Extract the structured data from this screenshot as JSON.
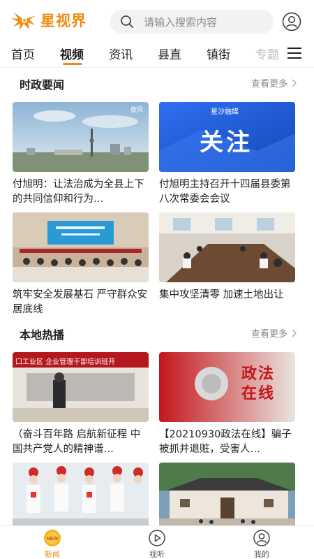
{
  "app": {
    "name": "星视界",
    "brand_color": "#f08a12"
  },
  "search": {
    "placeholder": "请输入搜索内容"
  },
  "nav": {
    "tabs": [
      {
        "label": "首页",
        "active": false
      },
      {
        "label": "视频",
        "active": true
      },
      {
        "label": "资讯",
        "active": false
      },
      {
        "label": "县直",
        "active": false
      },
      {
        "label": "镇街",
        "active": false
      },
      {
        "label": "专题",
        "active": false
      }
    ],
    "menu_icon": "hamburger-menu-icon"
  },
  "sections": [
    {
      "title": "时政要闻",
      "more_label": "查看更多",
      "items": [
        {
          "title": "付旭明：让法治成为全县上下的共同信仰和行为…",
          "thumb_label": "旋风"
        },
        {
          "title": "付旭明主持召开十四届县委第八次常委会会议",
          "thumb_label": "关注",
          "thumb_brand": "星沙融媒"
        },
        {
          "title": "筑牢安全发展基石 严守群众安居底线",
          "thumb_label": ""
        },
        {
          "title": "集中攻坚清零 加速土地出让",
          "thumb_label": ""
        }
      ]
    },
    {
      "title": "本地热播",
      "more_label": "查看更多",
      "items": [
        {
          "title": "（奋斗百年路 启航新征程 中国共产党人的精神谱…",
          "thumb_label": "口工业区 企业管理干部培训班开"
        },
        {
          "title": "【20210930政法在线】骗子被抓并退赃，受害人…",
          "thumb_label": "政法在线"
        },
        {
          "title": "",
          "thumb_label": ""
        },
        {
          "title": "",
          "thumb_label": ""
        }
      ]
    }
  ],
  "bottom_bar": {
    "items": [
      {
        "label": "新闻",
        "icon": "news-icon",
        "active": true
      },
      {
        "label": "视听",
        "icon": "play-icon",
        "active": false
      },
      {
        "label": "我的",
        "icon": "profile-icon",
        "active": false
      }
    ]
  }
}
